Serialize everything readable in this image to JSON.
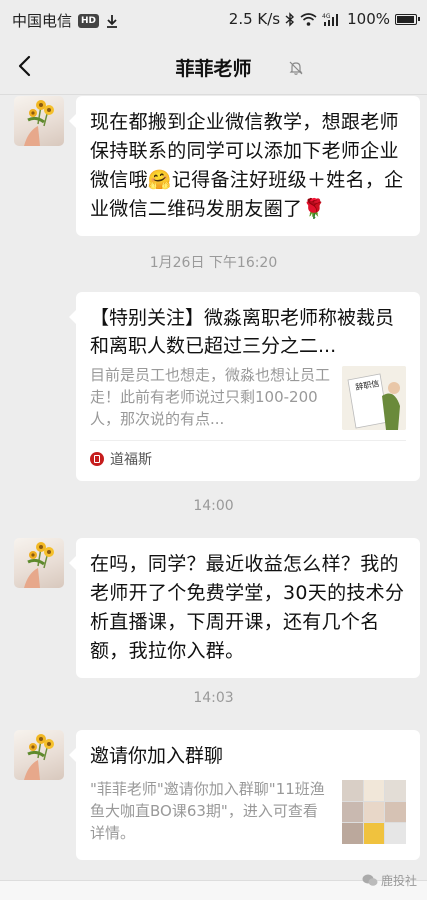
{
  "status_bar": {
    "carrier": "中国电信",
    "hd": "HD",
    "speed": "2.5 K/s",
    "network": "4G",
    "battery": "100%",
    "battery_level": 1.0
  },
  "header": {
    "title": "菲菲老师"
  },
  "messages": [
    {
      "type": "text",
      "parts": [
        "现在都搬到企业微信教学，想跟老师保持联系的同学可以添加下老师企业微信哦",
        "🤗",
        "记得备注好班级＋姓名，企业微信二维码发朋友圈了",
        "🌹"
      ]
    },
    {
      "type": "time",
      "text": "1月26日 下午16:20"
    },
    {
      "type": "link_card",
      "title": "【特别关注】微淼离职老师称被裁员和离职人数已超过三分之二...",
      "desc": "目前是员工也想走，微淼也想让员工走！此前有老师说过只剩100-200人，那次说的有点...",
      "thumb_text": "辞职信",
      "source": "道福斯"
    },
    {
      "type": "time",
      "text": "14:00"
    },
    {
      "type": "text",
      "text": "在吗，同学？最近收益怎么样？我的老师开了个免费学堂，30天的技术分析直播课，下周开课，还有几个名额，我拉你入群。"
    },
    {
      "type": "time",
      "text": "14:03"
    },
    {
      "type": "invite_card",
      "title": "邀请你加入群聊",
      "desc": "\"菲菲老师\"邀请你加入群聊\"11班渔鱼大咖直BO课63期\"，进入可查看详情。"
    }
  ],
  "watermark": "鹿投社",
  "colors": {
    "background": "#ededed",
    "bubble": "#ffffff",
    "time_text": "#9a9a9a",
    "source_logo": "#c61d1d"
  }
}
